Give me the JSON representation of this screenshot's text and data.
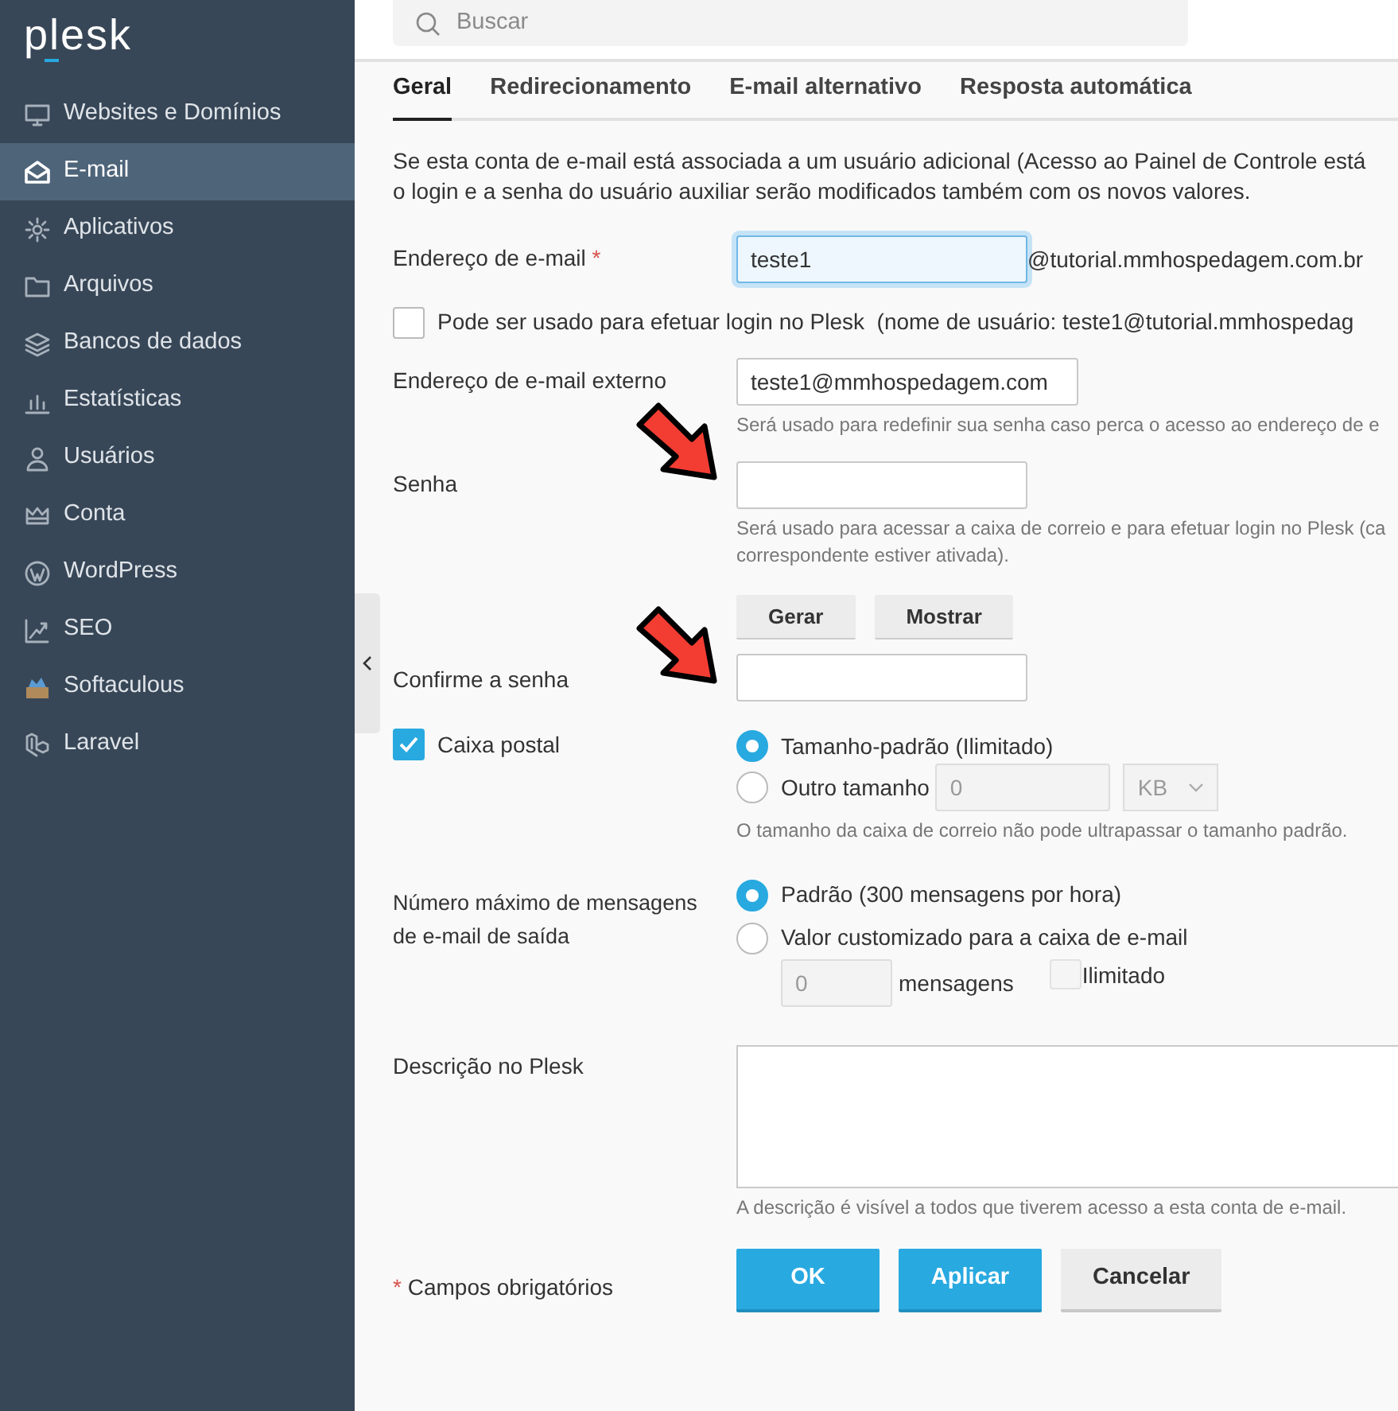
{
  "logo": {
    "text": "plesk"
  },
  "sidebar": {
    "items": [
      {
        "label": "Websites e Domínios",
        "selected": false
      },
      {
        "label": "E-mail",
        "selected": true
      },
      {
        "label": "Aplicativos",
        "selected": false
      },
      {
        "label": "Arquivos",
        "selected": false
      },
      {
        "label": "Bancos de dados",
        "selected": false
      },
      {
        "label": "Estatísticas",
        "selected": false
      },
      {
        "label": "Usuários",
        "selected": false
      },
      {
        "label": "Conta",
        "selected": false
      },
      {
        "label": "WordPress",
        "selected": false
      },
      {
        "label": "SEO",
        "selected": false
      },
      {
        "label": "Softaculous",
        "selected": false
      },
      {
        "label": "Laravel",
        "selected": false
      }
    ]
  },
  "search": {
    "placeholder": "Buscar"
  },
  "tabs": [
    {
      "label": "Geral",
      "selected": true
    },
    {
      "label": "Redirecionamento",
      "selected": false
    },
    {
      "label": "E-mail alternativo",
      "selected": false
    },
    {
      "label": "Resposta automática",
      "selected": false
    }
  ],
  "intro_lines": [
    "Se esta conta de e-mail está associada a um usuário adicional (Acesso ao Painel de Controle está",
    "o login e a senha do usuário auxiliar serão modificados também com os novos valores."
  ],
  "email": {
    "label": "Endereço de e-mail",
    "required_mark": "*",
    "value": "teste1",
    "suffix": "@tutorial.mmhospedagem.com.br",
    "focused": true
  },
  "login_option": {
    "checked": false,
    "label": "Pode ser usado para efetuar login no Plesk  (nome de usuário: teste1@tutorial.mmhospedag"
  },
  "external_email": {
    "label": "Endereço de e-mail externo",
    "value": "teste1@mmhospedagem.com",
    "hint": "Será usado para redefinir sua senha caso perca o acesso ao endereço de e"
  },
  "password": {
    "label": "Senha",
    "hint_lines": [
      "Será usado para acessar a caixa de correio e para efetuar login no Plesk (ca",
      "correspondente estiver ativada)."
    ],
    "buttons": [
      "Gerar",
      "Mostrar"
    ]
  },
  "confirm_password": {
    "label": "Confirme a senha"
  },
  "mailbox": {
    "label": "Caixa postal",
    "checked": true,
    "options": [
      {
        "label": "Tamanho-padrão (Ilimitado)",
        "selected": true
      },
      {
        "label": "Outro tamanho",
        "selected": false,
        "size_value": "0",
        "unit": "KB"
      }
    ],
    "hint": "O tamanho da caixa de correio não pode ultrapassar o tamanho padrão."
  },
  "outgoing_limit": {
    "label": "Número máximo de mensagens de e-mail de saída",
    "options": [
      {
        "label": "Padrão (300 mensagens por hora)",
        "selected": true
      },
      {
        "label": "Valor customizado para a caixa de e-mail",
        "selected": false,
        "count_value": "0",
        "count_unit": "mensagens",
        "unlimited": {
          "label": "Ilimitado",
          "checked": false
        }
      }
    ]
  },
  "description": {
    "label": "Descrição no Plesk",
    "hint": "A descrição é visível a todos que tiverem acesso a esta conta de e-mail."
  },
  "required_note": {
    "mark": "*",
    "text": "Campos obrigatórios"
  },
  "buttons": [
    {
      "label": "OK",
      "kind": "primary"
    },
    {
      "label": "Aplicar",
      "kind": "primary"
    },
    {
      "label": "Cancelar",
      "kind": "secondary"
    }
  ]
}
